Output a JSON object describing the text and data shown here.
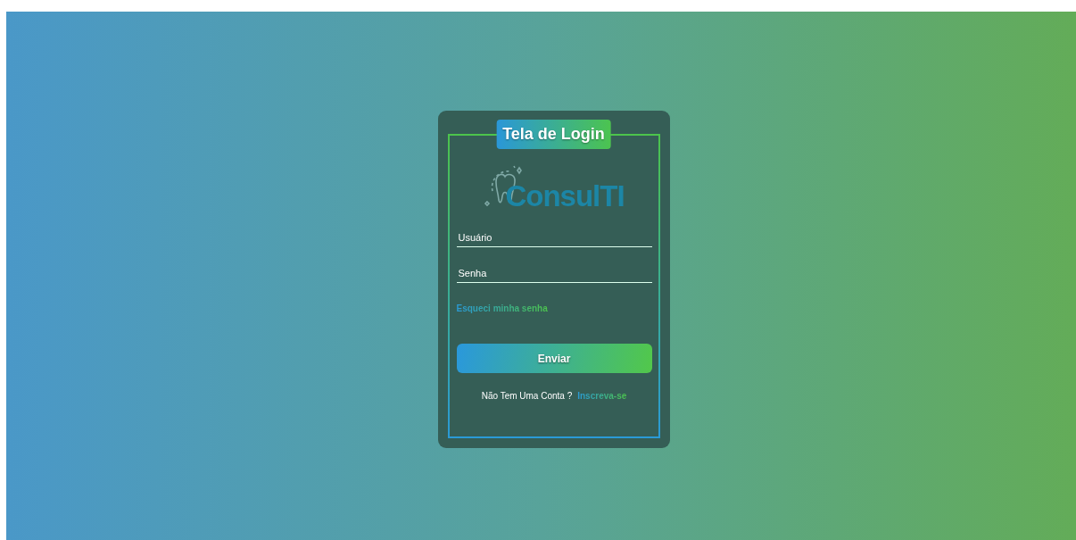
{
  "title": "Tela de Login",
  "logo": {
    "text": "ConsulTI"
  },
  "fields": [
    {
      "placeholder": "Usuário"
    },
    {
      "placeholder": "Senha"
    }
  ],
  "forgot_link": "Esqueci minha senha",
  "submit_button": "Enviar",
  "signup": {
    "prompt": "Não Tem Uma Conta ?",
    "link": "Inscreva-se"
  }
}
